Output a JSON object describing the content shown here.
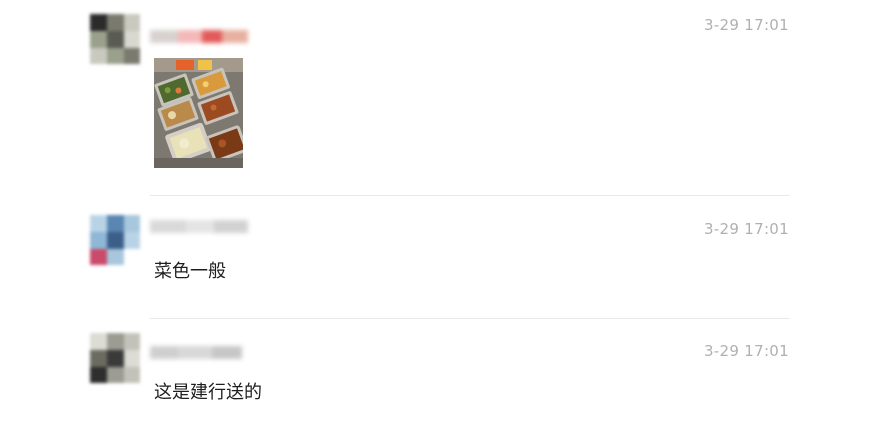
{
  "comments": [
    {
      "author": "",
      "timestamp": "3-29 17:01",
      "text": "",
      "attachment_icon": "photo-of-food-trays",
      "colors": {
        "avatar": [
          "#2b2b2b",
          "#7a7a6e",
          "#c9c9c0",
          "#9aa08c",
          "#d8d8d0",
          "#5b5b55"
        ],
        "username": [
          "#d7d2cf",
          "#f4b8b8",
          "#e25a5a",
          "#e7b0a0"
        ]
      }
    },
    {
      "author": "",
      "timestamp": "3-29 17:01",
      "text": "菜色一般",
      "attachment_icon": "",
      "colors": {
        "avatar": [
          "#8fb7d6",
          "#5a86b3",
          "#b9d3e6",
          "#3c5f8a",
          "#c94a6a",
          "#a8c7dd"
        ],
        "username": [
          "#d9d9d9",
          "#e4e4e4",
          "#d2d2d2"
        ]
      }
    },
    {
      "author": "",
      "timestamp": "3-29 17:01",
      "text": "这是建行送的",
      "attachment_icon": "",
      "colors": {
        "avatar": [
          "#3a3a3a",
          "#9c9c92",
          "#dcdcd4",
          "#6b6b62",
          "#c2c2b8",
          "#2e2e2e"
        ],
        "username": [
          "#cfcfcf",
          "#d8d8d8",
          "#c7c7c7"
        ]
      }
    }
  ]
}
